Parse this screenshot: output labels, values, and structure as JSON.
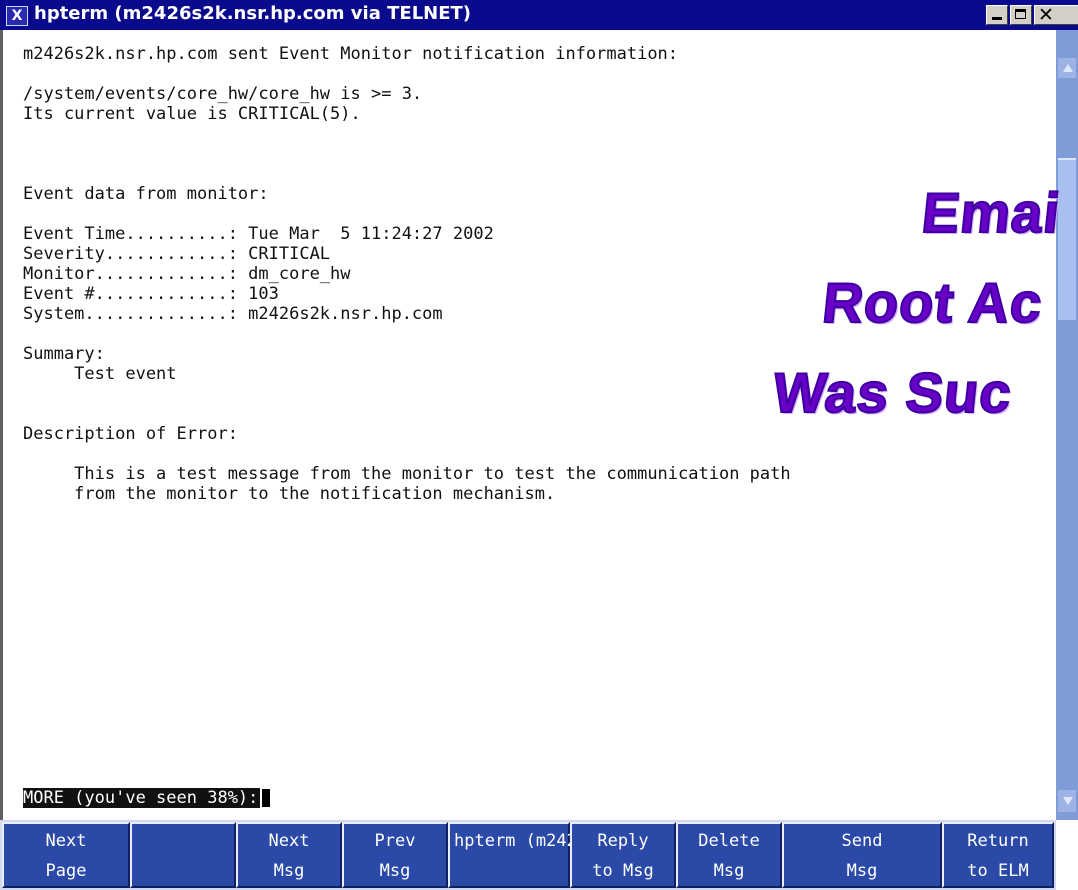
{
  "window": {
    "title": "hpterm (m2426s2k.nsr.hp.com via TELNET)",
    "icon_glyph": "X",
    "minimize_icon": "minimize-icon",
    "maximize_icon": "maximize-icon",
    "close_icon": "close-icon"
  },
  "terminal": {
    "lines": [
      "m2426s2k.nsr.hp.com sent Event Monitor notification information:",
      "",
      "/system/events/core_hw/core_hw is >= 3.",
      "Its current value is CRITICAL(5).",
      "",
      "",
      "",
      "Event data from monitor:",
      "",
      "Event Time..........: Tue Mar  5 11:24:27 2002",
      "Severity............: CRITICAL",
      "Monitor.............: dm_core_hw",
      "Event #.............: 103",
      "System..............: m2426s2k.nsr.hp.com",
      "",
      "Summary:",
      "     Test event",
      "",
      "",
      "Description of Error:",
      "",
      "     This is a test message from the monitor to test the communication path",
      "     from the monitor to the notification mechanism."
    ],
    "more_prompt": "MORE (you've seen 38%):"
  },
  "function_keys": [
    {
      "line1": "Next",
      "line2": "Page"
    },
    {
      "line1": "",
      "line2": ""
    },
    {
      "line1": "Next",
      "line2": "Msg"
    },
    {
      "line1": "Prev",
      "line2": "Msg"
    },
    {
      "line1": "hpterm (m242",
      "line2": ""
    },
    {
      "line1": "Reply",
      "line2": "to Msg"
    },
    {
      "line1": "Delete",
      "line2": "Msg"
    },
    {
      "line1": "Send",
      "line2": "Msg"
    },
    {
      "line1": "Return",
      "line2": "to ELM"
    }
  ],
  "overlay": {
    "line1": "Emai",
    "line2": "Root Ac",
    "line3": "Was Suc"
  },
  "colors": {
    "title_bar": "#0a0a8c",
    "function_key": "#2b49a7",
    "scrollbar": "#7f9bd8",
    "overlay_text": "#6a00c8"
  }
}
